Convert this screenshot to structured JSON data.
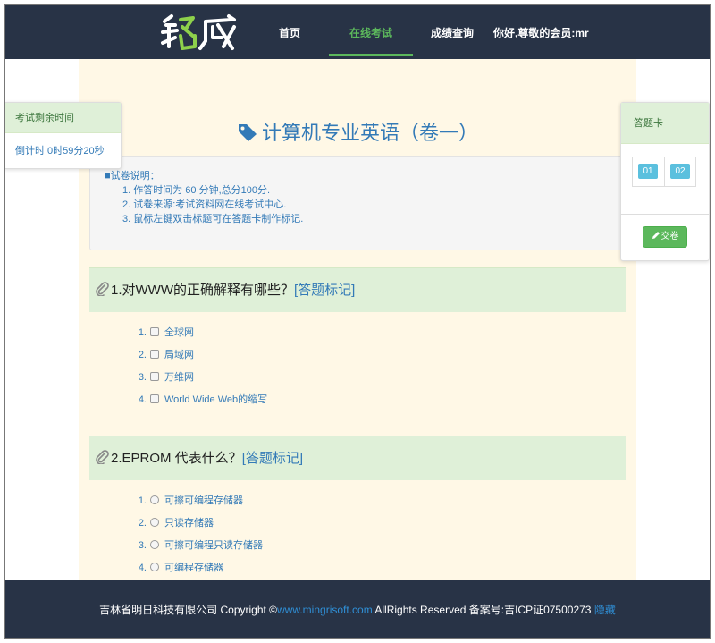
{
  "header": {
    "nav": [
      {
        "label": "首页"
      },
      {
        "label": "在线考试",
        "active": true
      },
      {
        "label": "成绩查询"
      }
    ],
    "greeting": "你好,尊敬的会员:mr",
    "brand_color": "#283346",
    "accent_color": "#5cb85c"
  },
  "timer": {
    "title": "考试剩余时间",
    "countdown": "倒计时 0时59分20秒"
  },
  "exam": {
    "title": "计算机专业英语（卷一）",
    "instructions": {
      "heading": "■试卷说明：",
      "lines": [
        "1. 作答时间为 60 分钟,总分100分.",
        "2. 试卷来源:考试资料网在线考试中心.",
        "3. 鼠标左键双击标题可在答题卡制作标记."
      ]
    },
    "questions": [
      {
        "text": "1.对WWW的正确解释有哪些？",
        "mark_label": "[答题标记]",
        "input_type": "checkbox",
        "options": [
          {
            "num": "1.",
            "text": "全球网"
          },
          {
            "num": "2.",
            "text": "局域网"
          },
          {
            "num": "3.",
            "text": "万维网"
          },
          {
            "num": "4.",
            "text": "World Wide Web的缩写"
          }
        ]
      },
      {
        "text": "2.EPROM 代表什么？",
        "mark_label": "[答题标记]",
        "input_type": "radio",
        "options": [
          {
            "num": "1.",
            "text": "可擦可编程存储器"
          },
          {
            "num": "2.",
            "text": "只读存储器"
          },
          {
            "num": "3.",
            "text": "可擦可编程只读存储器"
          },
          {
            "num": "4.",
            "text": "可编程存储器"
          }
        ]
      }
    ]
  },
  "answer_card": {
    "title": "答题卡",
    "items": [
      "01",
      "02"
    ],
    "submit_label": "交卷"
  },
  "footer": {
    "company": "吉林省明日科技有限公司 Copyright ©",
    "site_link": "www.mingrisoft.com",
    "rights": " AllRights Reserved 备案号:吉ICP证07500273 ",
    "hide_link": "隐藏"
  }
}
